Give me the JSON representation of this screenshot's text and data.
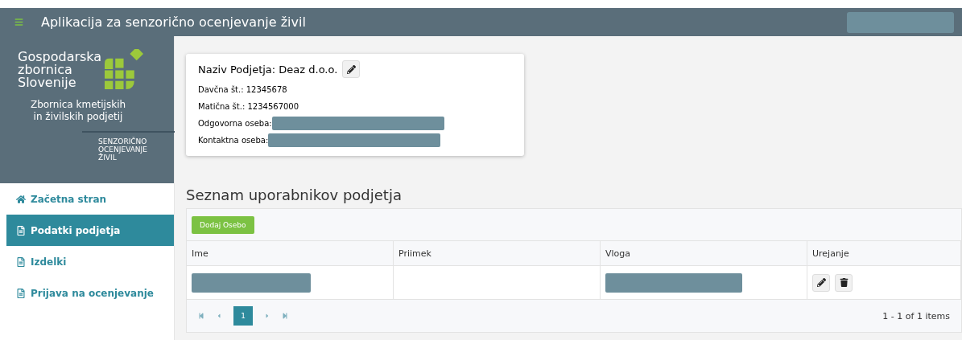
{
  "header": {
    "title": "Aplikacija za senzorično ocenjevanje živil"
  },
  "logo": {
    "name_lines": [
      "Gospodarska",
      "zbornica",
      "Slovenije"
    ],
    "subtitle_lines": [
      "Zbornica kmetijskih",
      "in živilskih podjetij"
    ],
    "app_lines": [
      "SENZORIČNO",
      "OCENJEVANJE",
      "ŽIVIL"
    ]
  },
  "sidebar": {
    "items": [
      {
        "label": "Začetna stran",
        "kind": "home",
        "selected": false
      },
      {
        "label": "Podatki podjetja",
        "kind": "doc",
        "selected": true
      },
      {
        "label": "Izdelki",
        "kind": "doc",
        "selected": false
      },
      {
        "label": "Prijava na ocenjevanje",
        "kind": "doc",
        "selected": false
      }
    ]
  },
  "company": {
    "name": "Naziv Podjetja: Deaz d.o.o.",
    "fields": [
      {
        "label": "Davčna št.: 12345678",
        "redacted": false
      },
      {
        "label": "Matična št.: 1234567000",
        "redacted": false
      },
      {
        "label": "Odgovorna oseba:",
        "redacted": true
      },
      {
        "label": "Kontaktna oseba:",
        "redacted": true
      }
    ]
  },
  "users": {
    "title": "Seznam uporabnikov podjetja",
    "add_button": "Dodaj Osebo",
    "columns": [
      "Ime",
      "Priimek",
      "Vloga",
      "Urejanje"
    ],
    "rows": [
      {
        "cells": [
          {
            "redacted": true
          },
          {
            "redacted": false
          },
          {
            "redacted": true
          }
        ]
      }
    ],
    "pager": {
      "pages": [
        {
          "label": "1",
          "selected": true
        }
      ],
      "info": "1 - 1 of 1 items"
    }
  }
}
